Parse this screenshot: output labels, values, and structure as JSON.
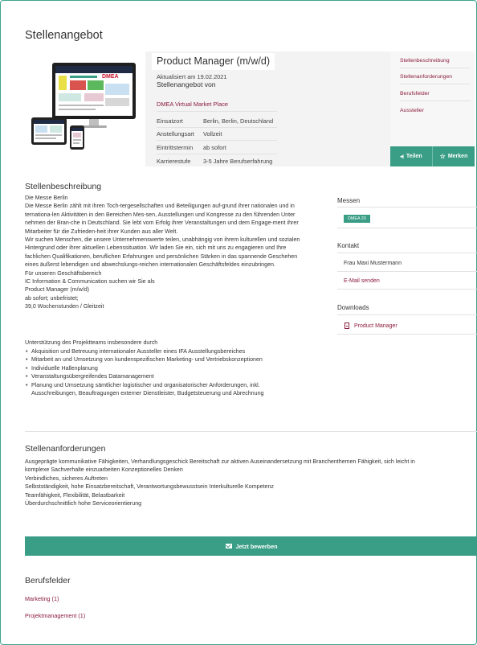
{
  "page": {
    "title": "Stellenangebot"
  },
  "job": {
    "title": "Product Manager (m/w/d)",
    "updated": "Aktualisiert am 19.02.2021",
    "offer_by": "Stellenangebot von",
    "company": "DMEA Virtual Market Place",
    "details": [
      {
        "label": "Einsatzort",
        "value": "Berlin, Berlin, Deutschland"
      },
      {
        "label": "Anstellungsart",
        "value": "Vollzeit"
      },
      {
        "label": "Eintrittstermin",
        "value": "ab sofort"
      },
      {
        "label": "Karrierestufe",
        "value": "3-5 Jahre Berufserfahrung"
      }
    ]
  },
  "image": {
    "logo_text": "DMEA"
  },
  "nav": {
    "links": [
      "Stellenbeschreibung",
      "Stellenanforderungen",
      "Berufsfelder",
      "Aussteller"
    ],
    "share_label": "Teilen",
    "save_label": "Merken"
  },
  "description": {
    "heading": "Stellenbeschreibung",
    "lines": [
      "Die Messe Berlin",
      "Die Messe Berlin zählt mit ihren Toch-tergesellschaften und Beteiligungen auf-grund ihrer nationalen und in",
      "ternationa-len Aktivitäten in den Bereichen Mes-sen, Ausstellungen und Kongresse zu den führenden Unter",
      "nehmen der Bran-che in Deutschland. Sie lebt vom Erfolg ihrer Veranstaltungen und dem Engage-ment ihrer",
      "Mitarbeiter für die Zufrieden-heit ihrer Kunden aus aller Welt.",
      "Wir suchen Menschen, die unsere Unternehmenswerte teilen, unabhängig von ihrem kulturellen und sozialen",
      "Hintergrund oder ihrer aktuellen Lebenssituation. Wir laden Sie ein, sich mit uns zu engagieren und Ihre",
      "fachlichen Qualifikationen, beruflichen Erfahrungen und persönlichen Stärken in das spannende Geschehen",
      "eines äußerst lebendigen und abwechslungs-reichen internationalen Geschäftsfeldes einzubringen.",
      "Für unseren Geschäftsbereich",
      "IC Information & Communication suchen wir Sie als",
      "Product Manager (m/w/d)",
      "ab sofort; unbefristet;",
      "39,0 Wochenstunden / Gleitzeit"
    ],
    "support_intro": "Unterstützung des Projektteams insbesondere durch",
    "bullets": [
      "Akquisition und Betreuung internationaler Aussteller eines IFA Ausstellungsbereiches",
      "Mitarbeit an und Umsetzung von kundenspezifischen Marketing- und Vertriebskonzeptionen",
      "Individuelle Hallenplanung",
      "Veranstaltungsübergreifendes Datamanagement",
      "Planung und Umsetzung sämtlicher logistischer und organisatorischer Anforderungen, inkl."
    ],
    "bullet_continuation": "Ausschreibungen, Beauftragungen externer Dienstleister, Budgetsteuerung und Abrechnung"
  },
  "sidebar": {
    "messen_heading": "Messen",
    "messen_tag": "DMEA 20",
    "kontakt_heading": "Kontakt",
    "contact_name": "Frau Maxi Mustermann",
    "email_link": "E-Mail senden",
    "downloads_heading": "Downloads",
    "download_file": "Product Manager"
  },
  "requirements": {
    "heading": "Stellenanforderungen",
    "lines": [
      "Ausgeprägte kommunikative Fähigkeiten, Verhandlungsgeschick Bereitschaft zur aktiven Auseinandersetzung mit Branchenthemen Fähigkeit, sich leicht in",
      "komplexe Sachverhalte einzuarbeiten Konzeptionelles Denken",
      "Verbindliches, sicheres Auftreten",
      "Selbstständigkeit, hohe Einsatzbereitschaft, Verantwortungsbewusstsein Interkulturelle Kompetenz",
      "Teamfähigkeit, Flexibilität, Belastbarkeit",
      "Überdurchschnittlich hohe Serviceorientierung"
    ]
  },
  "apply": {
    "label": "Jetzt bewerben"
  },
  "fields": {
    "heading": "Berufsfelder",
    "items": [
      "Marketing (1)",
      "Projektmanagement (1)"
    ]
  },
  "colors": {
    "accent": "#3a9d86",
    "link": "#8b1c3c",
    "frame": "#3aa58d"
  }
}
